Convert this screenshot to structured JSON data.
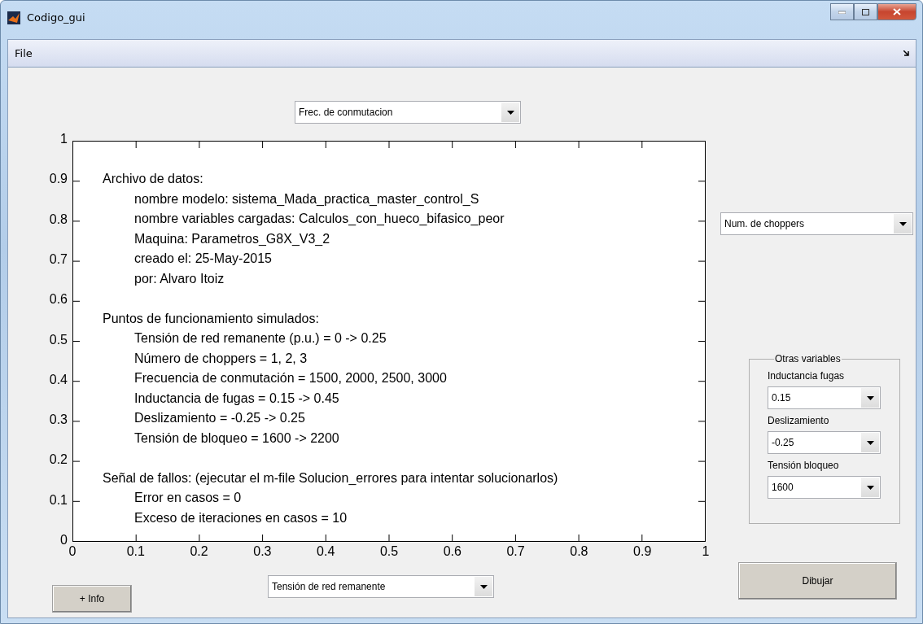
{
  "window": {
    "title": "Codigo_gui"
  },
  "menu": [
    {
      "label": "File"
    }
  ],
  "top_dropdown": {
    "value": "Frec. de conmutacion"
  },
  "axes": {
    "xticks": [
      "0",
      "0.1",
      "0.2",
      "0.3",
      "0.4",
      "0.5",
      "0.6",
      "0.7",
      "0.8",
      "0.9",
      "1"
    ],
    "yticks": [
      "1",
      "0.9",
      "0.8",
      "0.7",
      "0.6",
      "0.5",
      "0.4",
      "0.3",
      "0.2",
      "0.1",
      "0"
    ]
  },
  "info_sections": [
    {
      "heading": "Archivo de datos:",
      "lines": [
        "nombre modelo: sistema_Mada_practica_master_control_S",
        "nombre variables cargadas: Calculos_con_hueco_bifasico_peor",
        "Maquina: Parametros_G8X_V3_2",
        "creado el: 25-May-2015",
        "por: Alvaro Itoiz"
      ]
    },
    {
      "heading": "Puntos de funcionamiento simulados:",
      "lines": [
        "Tensión de red remanente (p.u.) = 0 -> 0.25",
        "Número de choppers = 1, 2, 3",
        "Frecuencia de conmutación = 1500, 2000, 2500, 3000",
        "Inductancia de fugas = 0.15 -> 0.45",
        "Deslizamiento = -0.25 -> 0.25",
        "Tensión de bloqueo = 1600 -> 2200"
      ]
    },
    {
      "heading": "Señal de fallos: (ejecutar el m-file Solucion_errores para intentar solucionarlos)",
      "lines": [
        "Error en casos = 0",
        "Exceso de iteraciones en casos = 10"
      ]
    }
  ],
  "right_dropdown": {
    "value": "Num. de choppers"
  },
  "other_variables": {
    "title": "Otras variables",
    "fields": [
      {
        "label": "Inductancia fugas",
        "value": "0.15"
      },
      {
        "label": "Deslizamiento",
        "value": "-0.25"
      },
      {
        "label": "Tensión bloqueo",
        "value": "1600"
      }
    ]
  },
  "bottom_dropdown": {
    "value": "Tensión de red remanente"
  },
  "buttons": {
    "info": "+ Info",
    "draw": "Dibujar"
  }
}
